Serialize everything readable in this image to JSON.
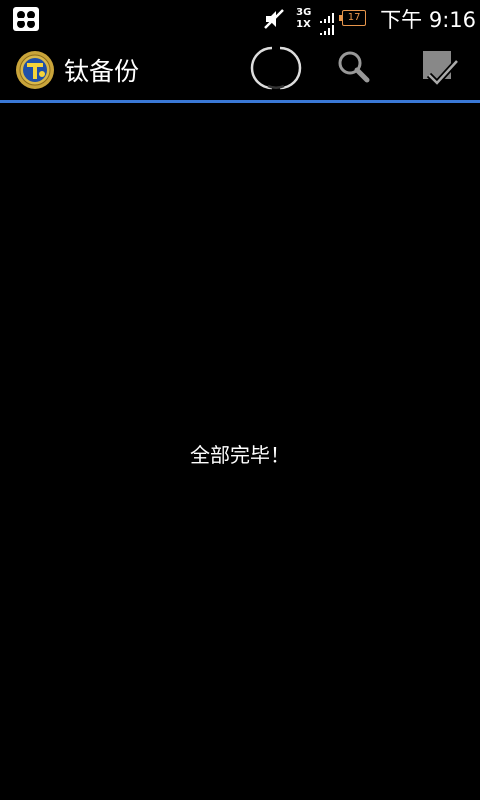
{
  "status_bar": {
    "left_icon": "notification-app-icon",
    "mute_icon": "mute-icon",
    "network_top": "3G",
    "network_bottom": "1X",
    "battery_level": "17",
    "time": "下午 9:16",
    "colors": {
      "battery": "#e8964c"
    }
  },
  "action_bar": {
    "app_icon": "titanium-backup-logo",
    "title": "钛备份",
    "actions": [
      {
        "icon": "progress-spinner-icon"
      },
      {
        "icon": "search-icon"
      },
      {
        "icon": "select-checkbox-icon"
      }
    ],
    "accent_color": "#3a78d6"
  },
  "content": {
    "message": "全部完毕！"
  }
}
